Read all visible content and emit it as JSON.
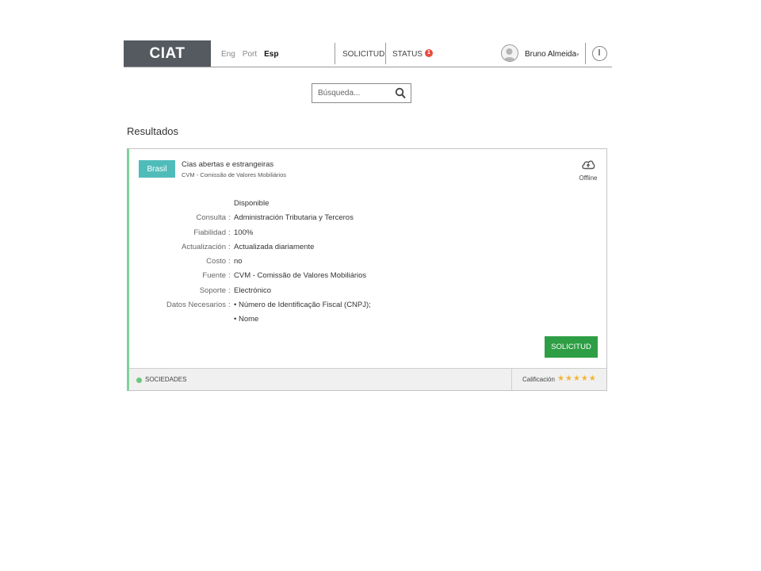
{
  "header": {
    "logo": "CIAT",
    "languages": [
      {
        "label": "Eng",
        "active": false
      },
      {
        "label": "Port",
        "active": false
      },
      {
        "label": "Esp",
        "active": true
      }
    ],
    "nav": {
      "solicitud": "SOLICITUD",
      "status": "STATUS",
      "status_count": "1"
    },
    "user": {
      "name": "Bruno Almeida",
      "caret": "▾"
    }
  },
  "search": {
    "placeholder": "Búsqueda..."
  },
  "results": {
    "title": "Resultados"
  },
  "card": {
    "country": "Brasil",
    "title": "Cias abertas e estrangeiras",
    "subtitle": "CVM - Comissão de Valores Mobiliários",
    "offline_label": "Offline",
    "details": [
      {
        "label": "",
        "value": "Disponible"
      },
      {
        "label": "Consulta",
        "value": "Administración Tributaria y Terceros"
      },
      {
        "label": "Fiabilidad",
        "value": "100%"
      },
      {
        "label": "Actualización",
        "value": "Actualizada diariamente"
      },
      {
        "label": "Costo",
        "value": "no"
      },
      {
        "label": "Fuente",
        "value": "CVM - Comissão de Valores Mobiliários"
      },
      {
        "label": "Soporte",
        "value": "Electrónico"
      },
      {
        "label": "Datos Necesarios",
        "value": "• Número de Identificação Fiscal (CNPJ);"
      },
      {
        "label": "",
        "value": "• Nome"
      }
    ],
    "separator": ":",
    "button_label": "SOLICITUD",
    "footer": {
      "category": "SOCIEDADES",
      "rating_label": "Calificación",
      "rating": 5,
      "rating_max": 5,
      "star_glyph": "★"
    }
  },
  "colors": {
    "logo_bg": "#555a60",
    "country_tag": "#4fbcba",
    "accent_border": "#7fd39a",
    "button": "#2e9e45",
    "badge": "#e84b3c",
    "star": "#f2b536"
  },
  "icons": {
    "search": "search-icon",
    "offline": "cloud-upload-icon",
    "avatar": "user-avatar-icon",
    "power": "power-icon"
  }
}
